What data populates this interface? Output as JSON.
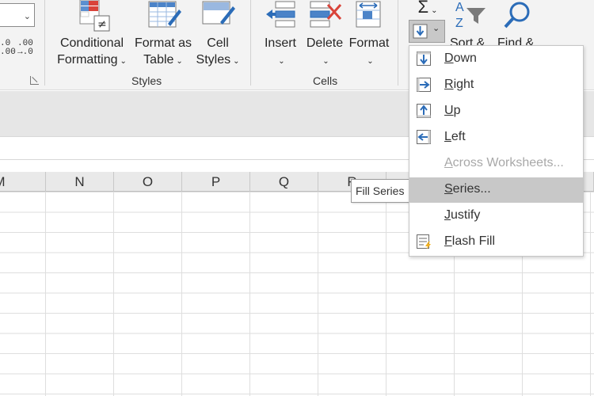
{
  "ribbon": {
    "decimal_buttons": {
      "increase_top": ".0",
      "increase_bottom": ".00",
      "decrease_top": ".00",
      "decrease_bottom": "→.0"
    },
    "styles_group": {
      "label": "Styles",
      "conditional_formatting": {
        "line1": "Conditional",
        "line2": "Formatting"
      },
      "format_as_table": {
        "line1": "Format as",
        "line2": "Table"
      },
      "cell_styles": {
        "line1": "Cell",
        "line2": "Styles"
      }
    },
    "cells_group": {
      "label": "Cells",
      "insert": "Insert",
      "delete": "Delete",
      "format": "Format"
    },
    "editing_group": {
      "sort_filter": "Sort &",
      "find_select": "Find &",
      "autosum_symbol": "Σ"
    },
    "dropdown_chevron": "⌄"
  },
  "grid": {
    "columns": [
      "M",
      "N",
      "O",
      "P",
      "Q",
      "R"
    ]
  },
  "tooltip": "Fill Series",
  "fill_menu": {
    "items": [
      {
        "key": "D",
        "rest": "own",
        "enabled": true,
        "icon": "fill-down-icon"
      },
      {
        "key": "R",
        "rest": "ight",
        "enabled": true,
        "icon": "fill-right-icon"
      },
      {
        "key": "U",
        "rest": "p",
        "enabled": true,
        "icon": "fill-up-icon"
      },
      {
        "key": "L",
        "rest": "eft",
        "enabled": true,
        "icon": "fill-left-icon"
      },
      {
        "key": "A",
        "rest": "cross Worksheets...",
        "enabled": false,
        "icon": ""
      },
      {
        "key": "S",
        "rest": "eries...",
        "enabled": true,
        "highlighted": true,
        "icon": ""
      },
      {
        "key": "J",
        "rest": "ustify",
        "enabled": true,
        "icon": ""
      },
      {
        "key": "F",
        "rest": "lash Fill",
        "enabled": true,
        "icon": "flash-fill-icon"
      }
    ]
  },
  "colors": {
    "accent_blue": "#2b6cb8",
    "delete_red": "#d9443a",
    "ribbon_bg": "#f3f3f3",
    "highlight": "#c8c8c8"
  }
}
